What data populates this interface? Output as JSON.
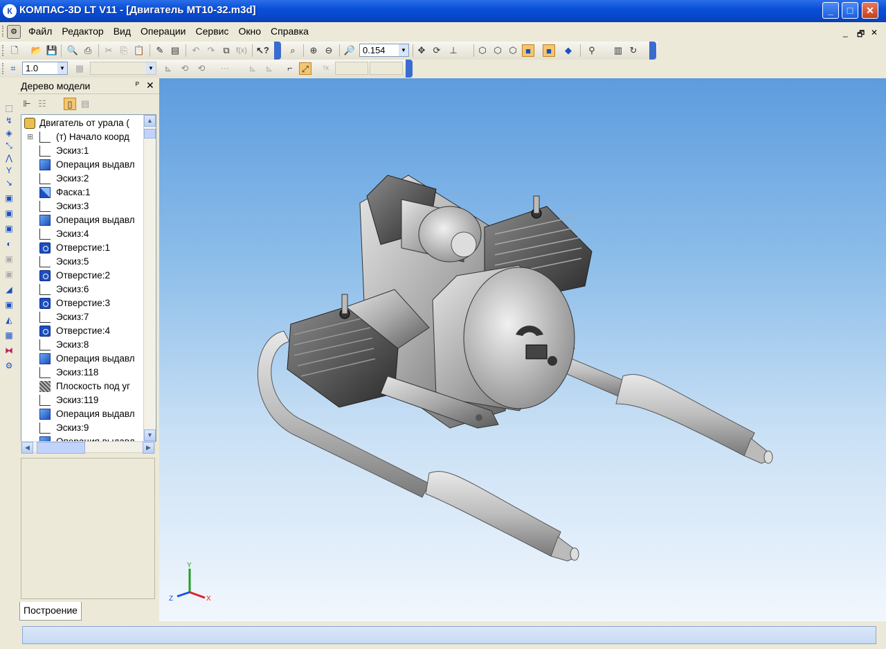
{
  "window": {
    "title": "КОМПАС-3D LT V11 - [Двигатель МТ10-32.m3d]",
    "app_icon": "kompas-logo-icon",
    "controls": {
      "minimize": "_",
      "maximize": "□",
      "close": "✕"
    }
  },
  "menu": {
    "items": [
      "Файл",
      "Редактор",
      "Вид",
      "Операции",
      "Сервис",
      "Окно",
      "Справка"
    ],
    "mdi_controls": {
      "minimize": "_",
      "restore": "🗗",
      "close": "✕"
    }
  },
  "toolbar_standard": {
    "zoom_value": "0.154",
    "icons": [
      "new-document-icon",
      "open-icon",
      "save-icon",
      "print-preview-icon",
      "print-icon",
      "cut-icon",
      "copy-icon",
      "paste-icon",
      "format-painter-icon",
      "properties-icon",
      "undo-icon",
      "redo-icon",
      "libraries-icon",
      "variables-icon",
      "help-cursor-icon",
      "zoom-frame-icon",
      "zoom-in-icon",
      "zoom-out-icon",
      "zoom-scale-icon",
      "pan-icon",
      "rotate-icon",
      "orientation-icon",
      "wireframe-icon",
      "hidden-lines-icon",
      "halftone-icon",
      "shaded-icon",
      "shaded-edges-icon",
      "perspective-icon",
      "filter-icon",
      "manager-icon",
      "rebuild-icon"
    ]
  },
  "toolbar_current_state": {
    "step_value": "1.0"
  },
  "model_tree": {
    "title": "Дерево модели",
    "pin": "ᴾ",
    "close": "✕",
    "root": "Двигатель от урала (",
    "items": [
      {
        "label": "(т) Начало коорд",
        "icon": "origin-icon",
        "type": "origin"
      },
      {
        "label": "Эскиз:1",
        "icon": "sketch-icon",
        "type": "sketch"
      },
      {
        "label": "Операция выдавл",
        "icon": "extrude-icon",
        "type": "extrude"
      },
      {
        "label": "Эскиз:2",
        "icon": "sketch-icon",
        "type": "sketch"
      },
      {
        "label": "Фаска:1",
        "icon": "chamfer-icon",
        "type": "chamfer"
      },
      {
        "label": "Эскиз:3",
        "icon": "sketch-icon",
        "type": "sketch"
      },
      {
        "label": "Операция выдавл",
        "icon": "extrude-icon",
        "type": "extrude"
      },
      {
        "label": "Эскиз:4",
        "icon": "sketch-icon",
        "type": "sketch"
      },
      {
        "label": "Отверстие:1",
        "icon": "hole-icon",
        "type": "hole"
      },
      {
        "label": "Эскиз:5",
        "icon": "sketch-icon",
        "type": "sketch"
      },
      {
        "label": "Отверстие:2",
        "icon": "hole-icon",
        "type": "hole"
      },
      {
        "label": "Эскиз:6",
        "icon": "sketch-icon",
        "type": "sketch"
      },
      {
        "label": "Отверстие:3",
        "icon": "hole-icon",
        "type": "hole"
      },
      {
        "label": "Эскиз:7",
        "icon": "sketch-icon",
        "type": "sketch"
      },
      {
        "label": "Отверстие:4",
        "icon": "hole-icon",
        "type": "hole"
      },
      {
        "label": "Эскиз:8",
        "icon": "sketch-icon",
        "type": "sketch"
      },
      {
        "label": "Операция выдавл",
        "icon": "extrude-icon",
        "type": "extrude"
      },
      {
        "label": "Эскиз:118",
        "icon": "sketch-icon",
        "type": "sketch"
      },
      {
        "label": "Плоскость под уг",
        "icon": "plane-icon",
        "type": "plane"
      },
      {
        "label": "Эскиз:119",
        "icon": "sketch-icon",
        "type": "sketch"
      },
      {
        "label": "Операция выдавл",
        "icon": "extrude-icon",
        "type": "extrude"
      },
      {
        "label": "Эскиз:9",
        "icon": "sketch-icon",
        "type": "sketch"
      },
      {
        "label": "Операция выдавл",
        "icon": "extrude-icon",
        "type": "extrude"
      }
    ]
  },
  "bottom_tab": {
    "label": "Построение"
  },
  "viewport": {
    "axes": {
      "x": "X",
      "y": "Y",
      "z": "Z"
    },
    "colors": {
      "x_axis": "#e02020",
      "y_axis": "#20a020",
      "z_axis": "#2050e0"
    }
  },
  "status": {
    "text": ""
  }
}
